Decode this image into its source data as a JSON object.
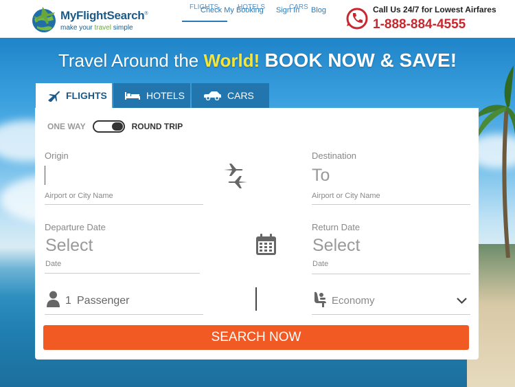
{
  "header": {
    "logo_name": "MyFlightSearch",
    "logo_tag_prefix": "make your ",
    "logo_tag_highlight": "travel",
    "logo_tag_suffix": " simple",
    "nav_overlap": [
      "FLIGHTS",
      "HOTELS",
      "CARS"
    ],
    "nav": [
      "Check My Booking",
      "Sign In",
      "Blog"
    ],
    "call_label": "Call Us 24/7 for Lowest Airfares",
    "call_number": "1-888-884-4555"
  },
  "hero": {
    "headline_prefix": "Travel Around the ",
    "headline_highlight": "World!",
    "headline_cta": "BOOK NOW & SAVE!"
  },
  "tabs": [
    {
      "label": "FLIGHTS",
      "icon": "plane-icon",
      "active": true
    },
    {
      "label": "HOTELS",
      "icon": "bed-icon",
      "active": false
    },
    {
      "label": "CARS",
      "icon": "car-icon",
      "active": false
    }
  ],
  "form": {
    "trip_one_way": "ONE WAY",
    "trip_round": "ROUND TRIP",
    "origin_label": "Origin",
    "origin_value": "",
    "origin_sub": "Airport or City Name",
    "destination_label": "Destination",
    "destination_placeholder": "To",
    "destination_sub": "Airport or City Name",
    "departure_label": "Departure Date",
    "departure_value": "Select",
    "departure_sub": "Date",
    "return_label": "Return Date",
    "return_value": "Select",
    "return_sub": "Date",
    "passenger_count": "1",
    "passenger_label": "Passenger",
    "cabin": "Economy",
    "search_label": "SEARCH NOW"
  },
  "colors": {
    "brand_blue": "#1a5b8a",
    "tab_blue": "#2375ad",
    "search_orange": "#f15a22",
    "phone_red": "#c8272d",
    "highlight_yellow": "#f5e53a"
  }
}
